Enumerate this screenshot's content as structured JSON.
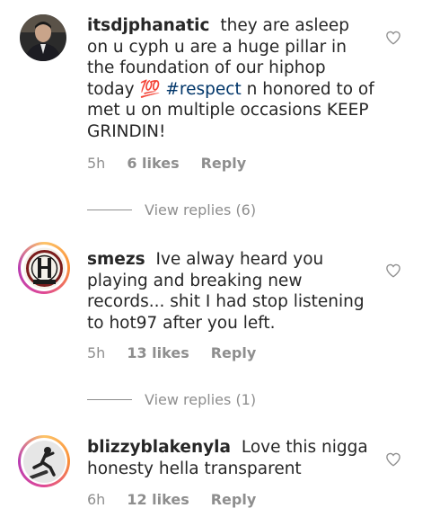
{
  "comments": [
    {
      "username": "itsdjphanatic",
      "text_before_tag": " they are asleep on u cyph u are a huge pillar in the foundation of our hiphop today ",
      "emoji": "💯",
      "hashtag": "#respect",
      "text_after_tag": " n honored to of met u on multiple occasions KEEP GRINDIN!",
      "time": "5h",
      "likes": "6 likes",
      "reply_label": "Reply",
      "view_replies": "View replies (6)",
      "avatar_icon": "profile-photo-man-suit"
    },
    {
      "username": "smezs",
      "text": " Ive alway heard you playing and breaking new records... shit I had stop listening to hot97 after you left.",
      "time": "5h",
      "likes": "13 likes",
      "reply_label": "Reply",
      "view_replies": "View replies (1)",
      "avatar_icon": "circular-logo-emblem"
    },
    {
      "username": "blizzyblakenyla",
      "text": " Love this nigga honesty hella transparent",
      "time": "6h",
      "likes": "12 likes",
      "reply_label": "Reply",
      "avatar_icon": "skateboarder-photo"
    }
  ],
  "colors": {
    "text": "#262626",
    "meta": "#8e8e8e",
    "hashtag": "#003569",
    "story_ring": [
      "#fdc468",
      "#fa8e37",
      "#df4996",
      "#b83db3"
    ]
  }
}
